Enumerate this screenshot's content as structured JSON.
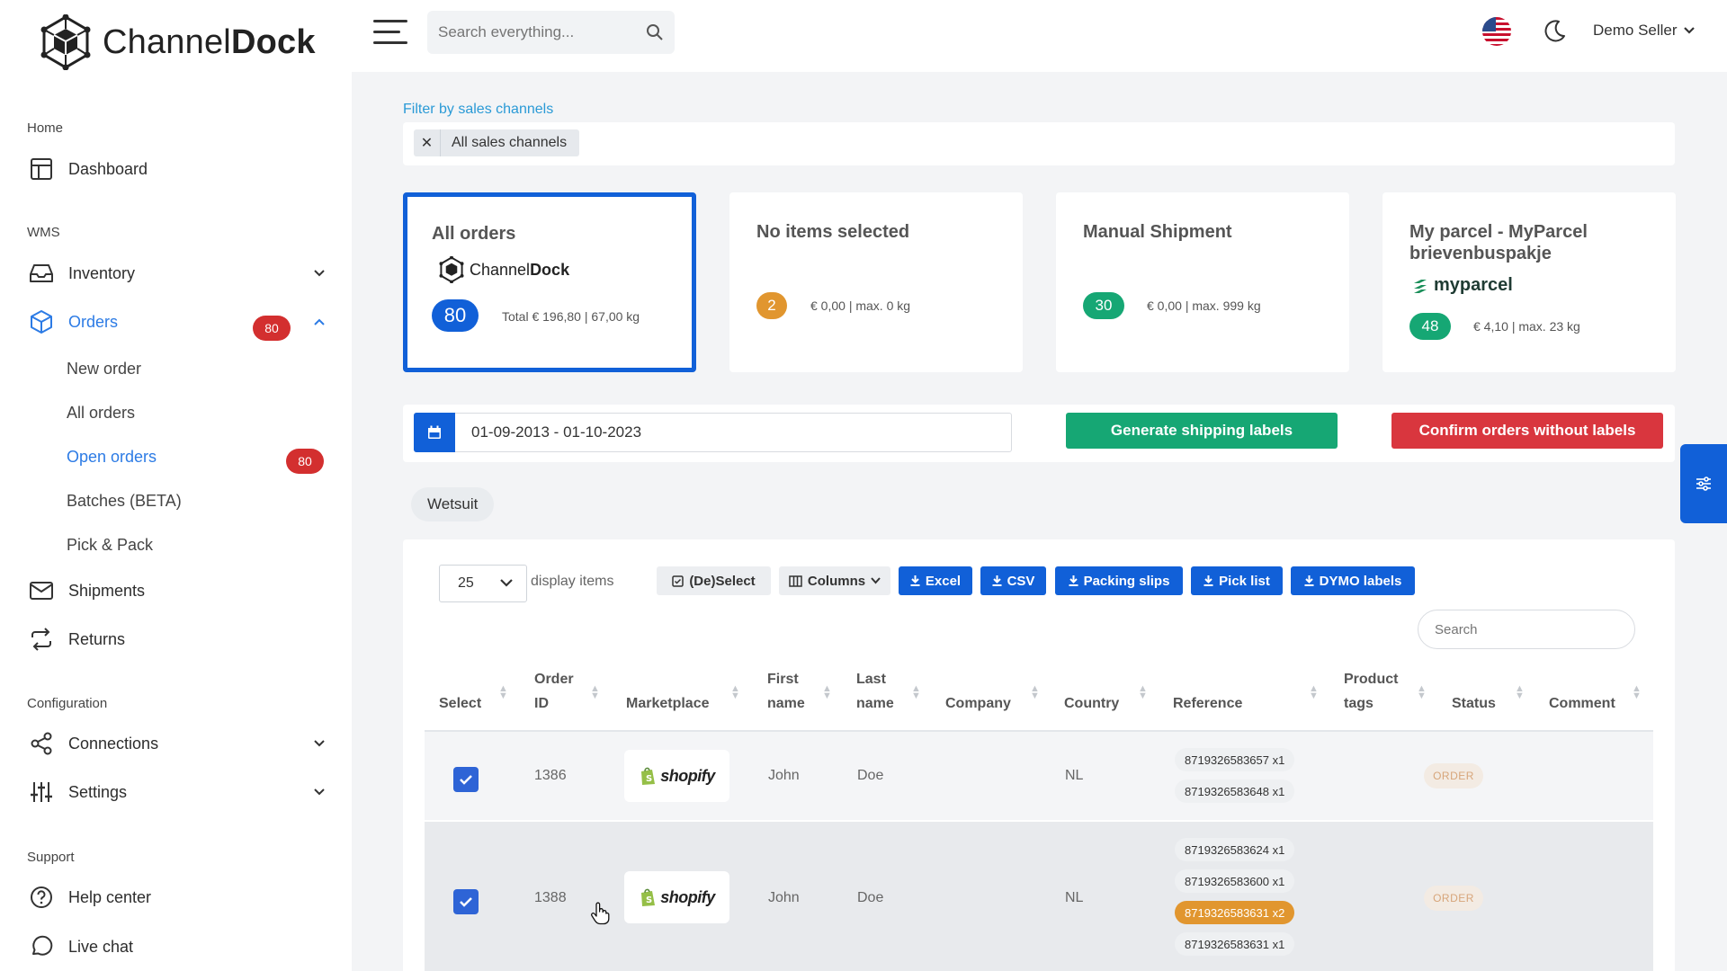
{
  "app": {
    "logo_text_a": "Channel",
    "logo_text_b": "Dock"
  },
  "sidebar": {
    "sections": {
      "home": "Home",
      "wms": "WMS",
      "configuration": "Configuration",
      "support": "Support"
    },
    "dashboard": "Dashboard",
    "inventory": "Inventory",
    "orders": "Orders",
    "orders_badge": "80",
    "sub": {
      "new_order": "New order",
      "all_orders": "All orders",
      "open_orders": "Open orders",
      "open_orders_badge": "80",
      "batches": "Batches (BETA)",
      "pick_pack": "Pick & Pack"
    },
    "shipments": "Shipments",
    "returns": "Returns",
    "connections": "Connections",
    "settings": "Settings",
    "help_center": "Help center",
    "live_chat": "Live chat"
  },
  "topbar": {
    "search_placeholder": "Search everything...",
    "user": "Demo Seller"
  },
  "filter": {
    "label": "Filter by sales channels",
    "chip": "All sales channels"
  },
  "cards": [
    {
      "title": "All orders",
      "brand_a": "Channel",
      "brand_b": "Dock",
      "count": "80",
      "meta": "Total € 196,80 | 67,00 kg"
    },
    {
      "title": "No items selected",
      "count": "2",
      "meta": "€ 0,00 | max. 0 kg"
    },
    {
      "title": "Manual Shipment",
      "count": "30",
      "meta": "€ 0,00 | max. 999 kg"
    },
    {
      "title": "My parcel - MyParcel brievenbuspakje",
      "brand": "myparcel",
      "count": "48",
      "meta": "€ 4,10 | max. 23 kg"
    }
  ],
  "actions": {
    "date_range": "01-09-2013 - 01-10-2023",
    "generate": "Generate shipping labels",
    "confirm": "Confirm orders without labels"
  },
  "tag": "Wetsuit",
  "table": {
    "per_page": "25",
    "per_page_label": "display items",
    "buttons": {
      "deselect": "(De)Select",
      "columns": "Columns",
      "excel": "Excel",
      "csv": "CSV",
      "packing_slips": "Packing slips",
      "pick_list": "Pick list",
      "dymo": "DYMO labels"
    },
    "search_placeholder": "Search",
    "headers": {
      "select": "Select",
      "order_id_1": "Order",
      "order_id_2": "ID",
      "marketplace": "Marketplace",
      "first_1": "First",
      "first_2": "name",
      "last_1": "Last",
      "last_2": "name",
      "company": "Company",
      "country": "Country",
      "reference": "Reference",
      "tags_1": "Product",
      "tags_2": "tags",
      "status": "Status",
      "comment": "Comment"
    },
    "rows": [
      {
        "id": "1386",
        "marketplace": "shopify",
        "first": "John",
        "last": "Doe",
        "country": "NL",
        "refs": [
          "8719326583657 x1",
          "8719326583648 x1"
        ],
        "status": "ORDER"
      },
      {
        "id": "1388",
        "marketplace": "shopify",
        "first": "John",
        "last": "Doe",
        "country": "NL",
        "refs": [
          "8719326583624 x1",
          "8719326583600 x1",
          "8719326583631 x2",
          "8719326583631 x1"
        ],
        "status": "ORDER"
      }
    ]
  },
  "colors": {
    "primary": "#1160d8",
    "green": "#16a774",
    "red": "#d9363e",
    "orange": "#e1962f",
    "link": "#2c7be5"
  }
}
